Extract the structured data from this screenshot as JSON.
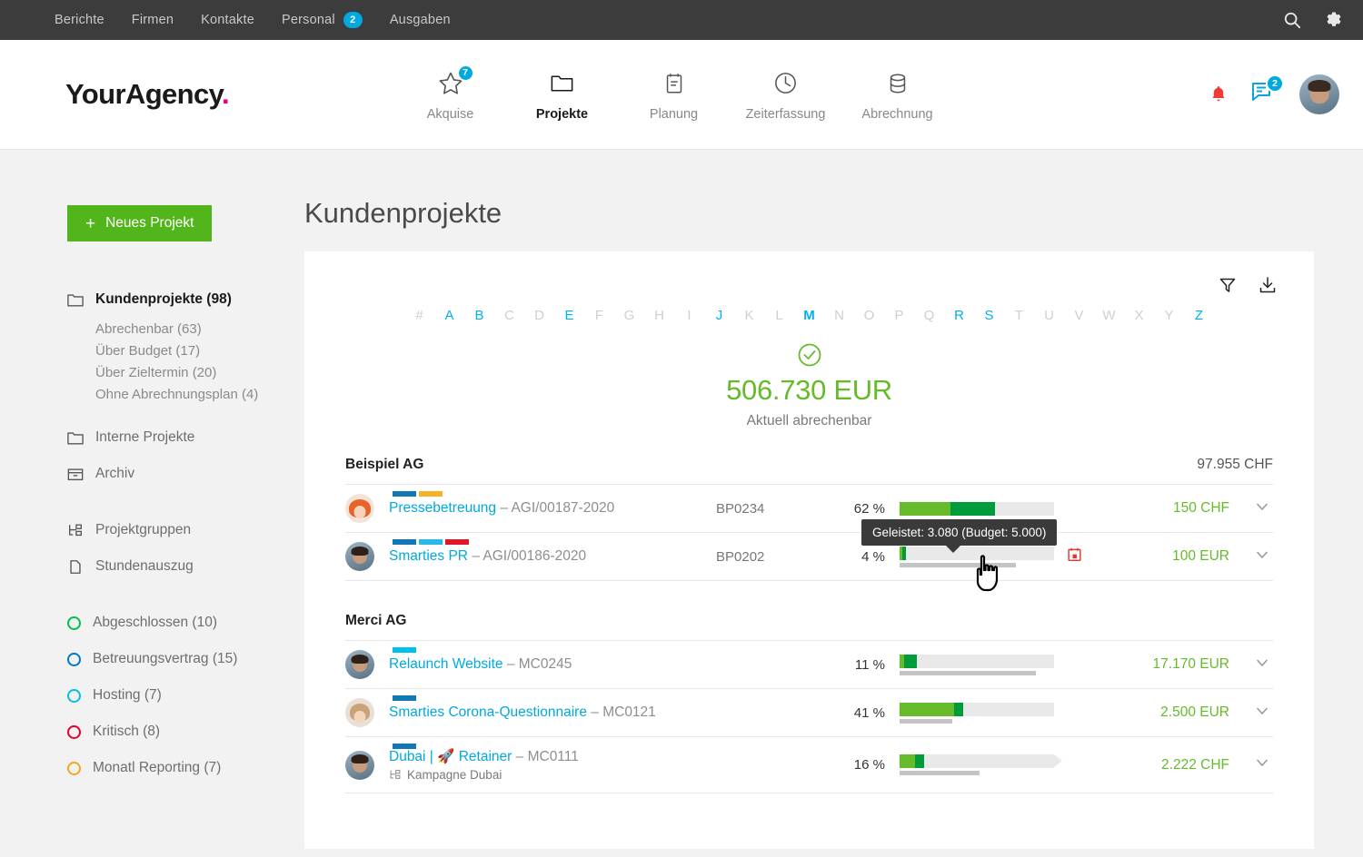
{
  "topbar": {
    "links": [
      {
        "label": "Berichte",
        "badge": null
      },
      {
        "label": "Firmen",
        "badge": null
      },
      {
        "label": "Kontakte",
        "badge": null
      },
      {
        "label": "Personal",
        "badge": "2"
      },
      {
        "label": "Ausgaben",
        "badge": null
      }
    ],
    "search_icon": "search-icon",
    "settings_icon": "gear-icon"
  },
  "header": {
    "logo": "YourAgency",
    "logo_dot": ".",
    "nav": [
      {
        "label": "Akquise",
        "icon": "star-icon",
        "badge": "7",
        "active": false
      },
      {
        "label": "Projekte",
        "icon": "folder-icon",
        "badge": null,
        "active": true
      },
      {
        "label": "Planung",
        "icon": "calendar-icon",
        "badge": null,
        "active": false
      },
      {
        "label": "Zeiterfassung",
        "icon": "clock-icon",
        "badge": null,
        "active": false
      },
      {
        "label": "Abrechnung",
        "icon": "database-icon",
        "badge": null,
        "active": false
      }
    ],
    "notification_icon": "bell-icon",
    "messages_icon": "chat-icon",
    "messages_badge": "2",
    "avatar": "user-avatar"
  },
  "sidebar": {
    "new_project_button": "Neues Projekt",
    "new_project_plus": "+",
    "primary": [
      {
        "label": "Kundenprojekte (98)",
        "icon": "folder-icon",
        "bold": true
      },
      {
        "label": "Interne Projekte",
        "icon": "folder-icon",
        "bold": false
      },
      {
        "label": "Archiv",
        "icon": "archive-icon",
        "bold": false
      }
    ],
    "sub_items": [
      "Abrechenbar (63)",
      "Über Budget (17)",
      "Über Zieltermin (20)",
      "Ohne Abrechnungsplan (4)"
    ],
    "secondary": [
      {
        "label": "Projektgruppen",
        "icon": "group-icon"
      },
      {
        "label": "Stundenauszug",
        "icon": "document-icon"
      }
    ],
    "status_items": [
      {
        "label": "Abgeschlossen (10)",
        "color": "#00c04b"
      },
      {
        "label": "Betreuungsvertrag (15)",
        "color": "#0078c8"
      },
      {
        "label": "Hosting (7)",
        "color": "#00c0e8"
      },
      {
        "label": "Kritisch (8)",
        "color": "#e8002a"
      },
      {
        "label": "Monatl Reporting (7)",
        "color": "#f5a623"
      }
    ]
  },
  "main": {
    "page_title": "Kundenprojekte",
    "filter_icon": "filter-icon",
    "download_icon": "download-icon",
    "alphabet": [
      {
        "ch": "#",
        "state": "off"
      },
      {
        "ch": "A",
        "state": "on"
      },
      {
        "ch": "B",
        "state": "on"
      },
      {
        "ch": "C",
        "state": "off"
      },
      {
        "ch": "D",
        "state": "off"
      },
      {
        "ch": "E",
        "state": "on"
      },
      {
        "ch": "F",
        "state": "off"
      },
      {
        "ch": "G",
        "state": "off"
      },
      {
        "ch": "H",
        "state": "off"
      },
      {
        "ch": "I",
        "state": "off"
      },
      {
        "ch": "J",
        "state": "on"
      },
      {
        "ch": "K",
        "state": "off"
      },
      {
        "ch": "L",
        "state": "off"
      },
      {
        "ch": "M",
        "state": "cur"
      },
      {
        "ch": "N",
        "state": "off"
      },
      {
        "ch": "O",
        "state": "off"
      },
      {
        "ch": "P",
        "state": "off"
      },
      {
        "ch": "Q",
        "state": "off"
      },
      {
        "ch": "R",
        "state": "on"
      },
      {
        "ch": "S",
        "state": "on"
      },
      {
        "ch": "T",
        "state": "off"
      },
      {
        "ch": "U",
        "state": "off"
      },
      {
        "ch": "V",
        "state": "off"
      },
      {
        "ch": "W",
        "state": "off"
      },
      {
        "ch": "X",
        "state": "off"
      },
      {
        "ch": "Y",
        "state": "off"
      },
      {
        "ch": "Z",
        "state": "on"
      }
    ],
    "summary": {
      "icon": "check-circle-icon",
      "amount": "506.730 EUR",
      "caption": "Aktuell abrechenbar"
    },
    "tooltip": "Geleistet: 3.080 (Budget: 5.000)",
    "groups": [
      {
        "name": "Beispiel AG",
        "total": "97.955 CHF",
        "rows": [
          {
            "name": "Pressebetreuung",
            "number": "– AGI/00187-2020",
            "sub": null,
            "code": "BP0234",
            "percent": "62 %",
            "bar": {
              "a": 33,
              "b": 29,
              "subbar": 0,
              "arrow": false
            },
            "warn": null,
            "amount": "150 CHF",
            "tags": [
              "#1178b5",
              "#f5b324"
            ]
          },
          {
            "name": "Smarties PR",
            "number": "– AGI/00186-2020",
            "sub": null,
            "code": "BP0202",
            "percent": "4 %",
            "bar": {
              "a": 2,
              "b": 2,
              "subbar": 75,
              "arrow": false
            },
            "warn": "calendar-alert-icon",
            "amount": "100 EUR",
            "tags": [
              "#1178b5",
              "#28b9e8",
              "#e0162b"
            ]
          }
        ]
      },
      {
        "name": "Merci AG",
        "total": null,
        "rows": [
          {
            "name": "Relaunch Website",
            "number": "– MC0245",
            "sub": null,
            "code": "",
            "percent": "11 %",
            "bar": {
              "a": 3,
              "b": 8,
              "subbar": 88,
              "arrow": false
            },
            "warn": null,
            "amount": "17.170 EUR",
            "tags": [
              "#00c0e8"
            ]
          },
          {
            "name": "Smarties Corona-Questionnaire",
            "number": "– MC0121",
            "sub": null,
            "code": "",
            "percent": "41 %",
            "bar": {
              "a": 35,
              "b": 6,
              "subbar": 34,
              "arrow": false
            },
            "warn": null,
            "amount": "2.500 EUR",
            "tags": [
              "#1178b5"
            ]
          },
          {
            "name": "Dubai | 🚀 Retainer",
            "number": "– MC0111",
            "sub": "Kampagne Dubai",
            "code": "",
            "percent": "16 %",
            "bar": {
              "a": 10,
              "b": 6,
              "subbar": 52,
              "arrow": true
            },
            "warn": null,
            "amount": "2.222 CHF",
            "tags": [
              "#1178b5"
            ]
          }
        ]
      }
    ]
  }
}
